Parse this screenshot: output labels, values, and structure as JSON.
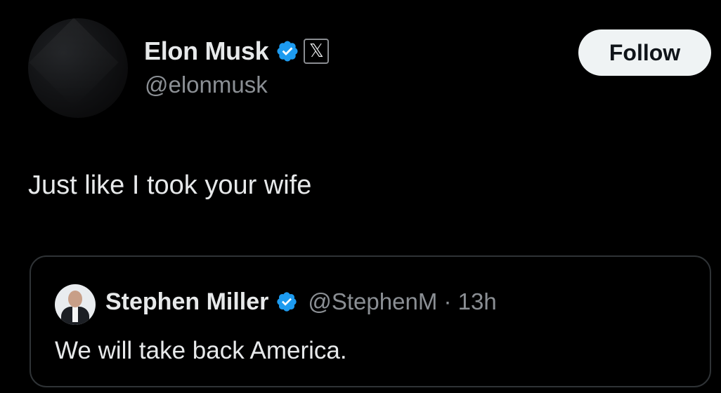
{
  "author": {
    "display_name": "Elon Musk",
    "handle": "@elonmusk",
    "verified_icon": "verified-badge-icon",
    "affiliate_icon": "x-logo-icon",
    "affiliate_glyph": "𝕏"
  },
  "follow_button": {
    "label": "Follow"
  },
  "tweet": {
    "text": "Just like I took your wife"
  },
  "quoted_tweet": {
    "display_name": "Stephen Miller",
    "handle": "@StephenM",
    "separator": "·",
    "time": "13h",
    "meta": "@StephenM · 13h",
    "text": "We will take back America."
  },
  "colors": {
    "background": "#000000",
    "text_primary": "#e7e9ea",
    "text_secondary": "#8b8f94",
    "verified_blue": "#1d9bf0",
    "follow_button_bg": "#eff3f4",
    "border": "#2f3336"
  }
}
